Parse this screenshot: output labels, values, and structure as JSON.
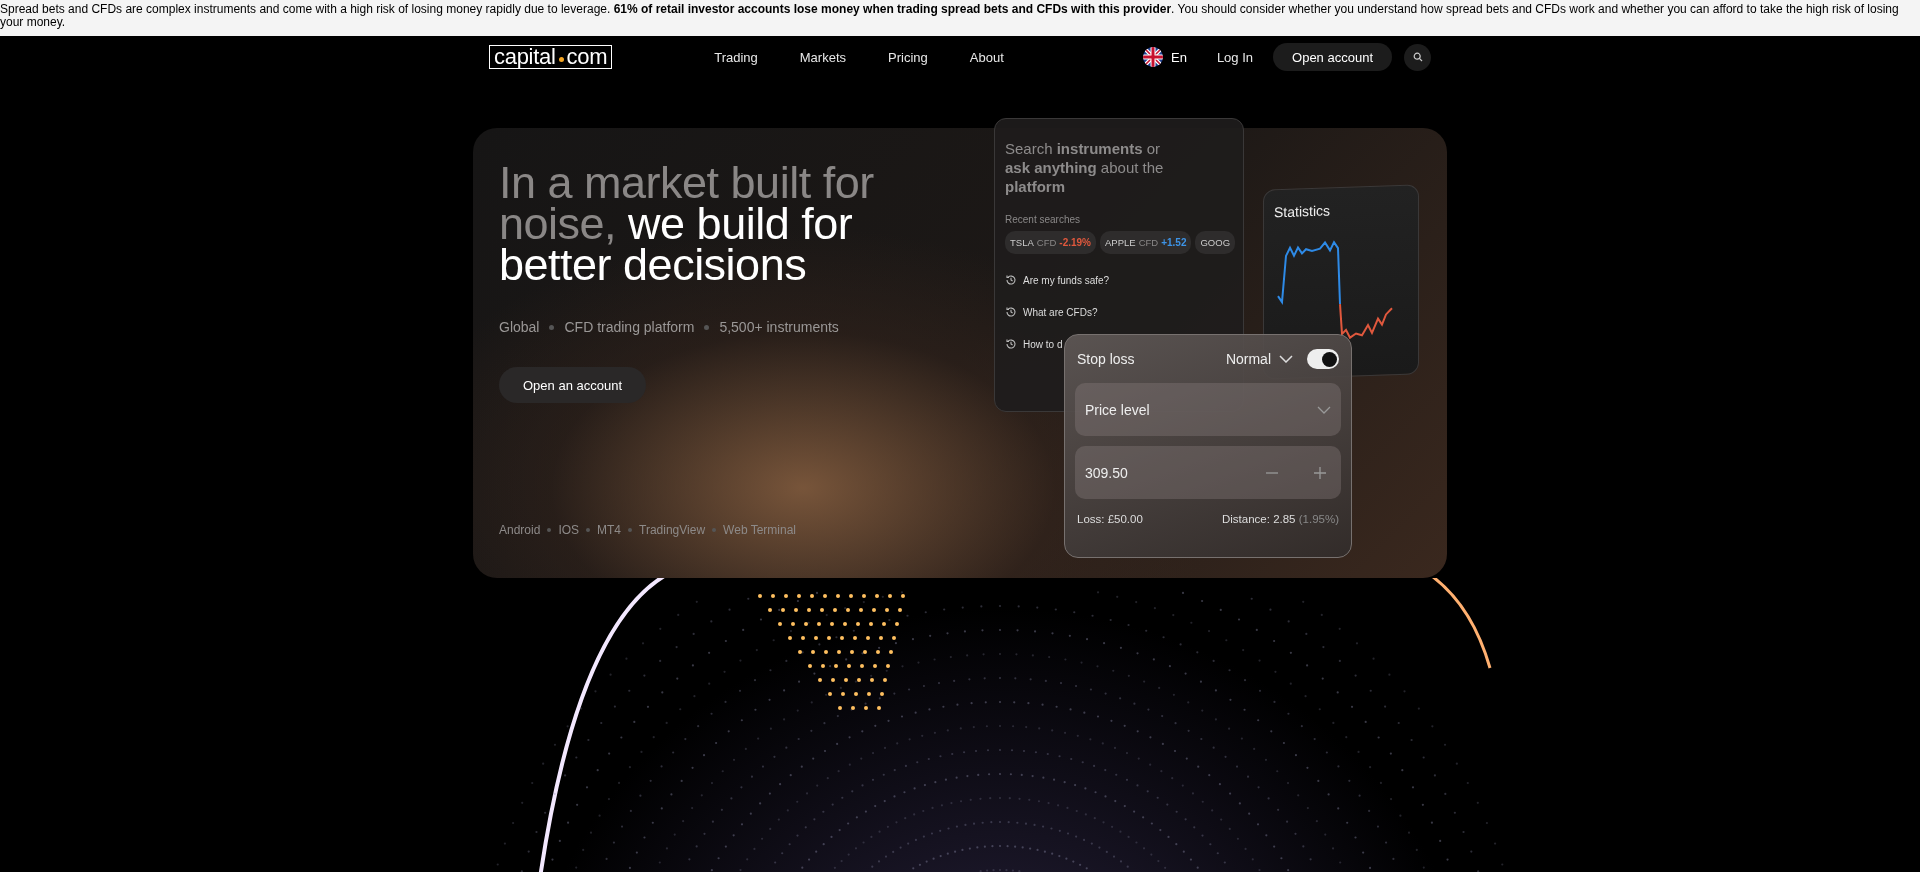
{
  "risk_banner": "Spread bets and CFDs are complex instruments and come with a high risk of losing money rapidly due to leverage. **61% of retail investor accounts lose money when trading spread bets and CFDs with this provider**. You should consider whether you understand how spread bets and CFDs work and whether you can afford to take the high risk of losing your money.",
  "nav": {
    "logo_left": "capital",
    "logo_right": "com",
    "links": [
      "Trading",
      "Markets",
      "Pricing",
      "About"
    ],
    "language": "En",
    "login": "Log In",
    "open_account": "Open account"
  },
  "hero": {
    "headline_muted": "In a market built for noise,",
    "headline_bright": "we build for better decisions",
    "tags": [
      "Global",
      "CFD trading platform",
      "5,500+ instruments"
    ],
    "cta": "Open an account",
    "platforms": [
      "Android",
      "IOS",
      "MT4",
      "TradingView",
      "Web Terminal"
    ]
  },
  "search_card": {
    "title": "Search **instruments** or **ask anything** about the **platform**",
    "recent_label": "Recent searches",
    "chips": [
      {
        "symbol": "TSLA",
        "type": "CFD",
        "change": "-2.19%",
        "color": "#e0583d"
      },
      {
        "symbol": "APPLE",
        "type": "CFD",
        "change": "+1.52",
        "color": "#3d93e6"
      },
      {
        "symbol": "GOOG"
      }
    ],
    "questions": [
      "Are my funds safe?",
      "What are CFDs?",
      "How to d"
    ]
  },
  "statistics_card": {
    "title": "Statistics"
  },
  "stop_loss": {
    "title": "Stop loss",
    "mode": "Normal",
    "on": true,
    "field_label": "Price level",
    "value": "309.50",
    "loss": "Loss: £50.00",
    "distance": "Distance: 2.85",
    "distance_pct": "(1.95%)"
  }
}
